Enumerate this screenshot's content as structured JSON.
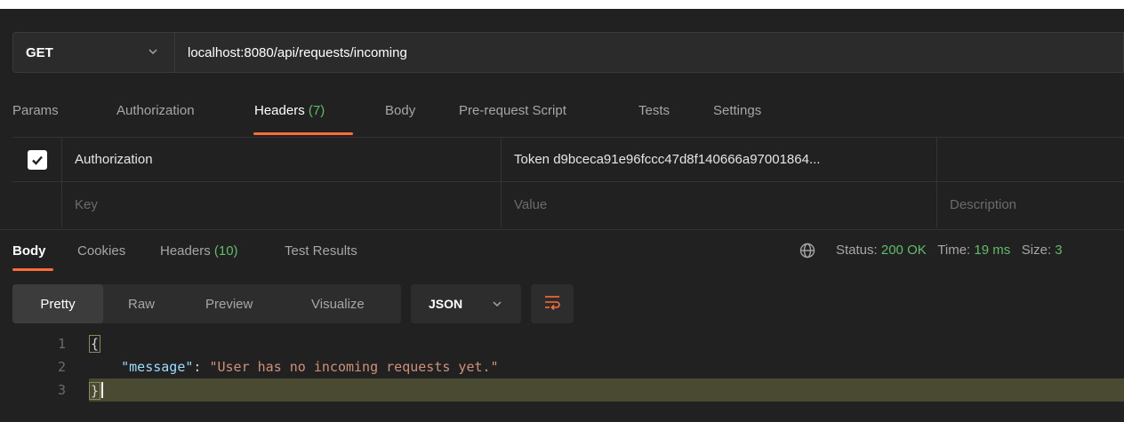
{
  "request": {
    "method": "GET",
    "url": "localhost:8080/api/requests/incoming"
  },
  "request_tabs": [
    {
      "label": "Params"
    },
    {
      "label": "Authorization"
    },
    {
      "label": "Headers",
      "count": "(7)",
      "active": true
    },
    {
      "label": "Body"
    },
    {
      "label": "Pre-request Script"
    },
    {
      "label": "Tests"
    },
    {
      "label": "Settings"
    }
  ],
  "headers_table": {
    "rows": [
      {
        "checked": true,
        "key": "Authorization",
        "value": "Token d9bceca91e96fccc47d8f140666a97001864..."
      }
    ],
    "placeholders": {
      "key": "Key",
      "value": "Value",
      "description": "Description"
    }
  },
  "response_tabs": [
    {
      "label": "Body",
      "active": true
    },
    {
      "label": "Cookies"
    },
    {
      "label": "Headers",
      "count": "(10)"
    },
    {
      "label": "Test Results"
    }
  ],
  "response_status": {
    "status_label": "Status:",
    "status_value": "200 OK",
    "time_label": "Time:",
    "time_value": "19 ms",
    "size_label": "Size:",
    "size_value": "3"
  },
  "view_modes": [
    {
      "label": "Pretty",
      "active": true
    },
    {
      "label": "Raw"
    },
    {
      "label": "Preview"
    },
    {
      "label": "Visualize"
    }
  ],
  "format": "JSON",
  "code_lines": [
    {
      "n": "1",
      "text": "{"
    },
    {
      "n": "2",
      "key": "\"message\"",
      "colon": ": ",
      "value": "\"User has no incoming requests yet.\""
    },
    {
      "n": "3",
      "text": "}"
    }
  ],
  "colors": {
    "accent": "#ff6c37",
    "success": "#5fbd6b",
    "background": "#212121"
  }
}
